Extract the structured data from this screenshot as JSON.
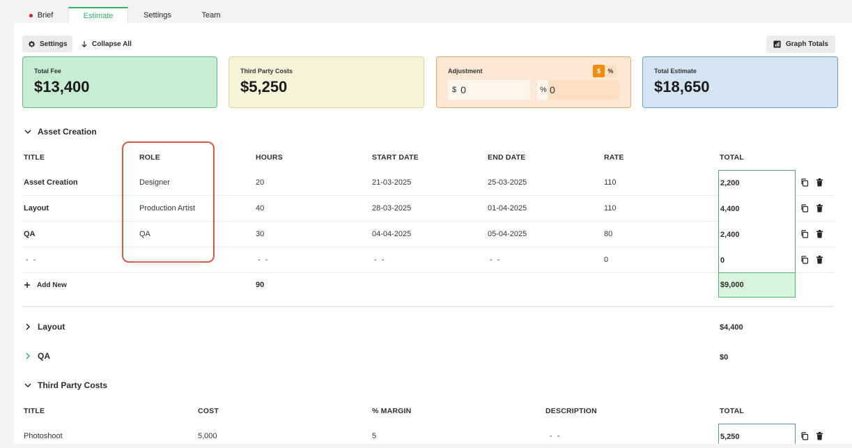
{
  "tabs": [
    {
      "label": "Brief",
      "active": false,
      "dot": true
    },
    {
      "label": "Estimate",
      "active": true
    },
    {
      "label": "Settings",
      "active": false
    },
    {
      "label": "Team",
      "active": false
    }
  ],
  "toolbar": {
    "settings_label": "Settings",
    "collapse_label": "Collapse All",
    "graph_label": "Graph Totals"
  },
  "cards": {
    "total_fee": {
      "label": "Total Fee",
      "value": "$13,400"
    },
    "third_party": {
      "label": "Third Party Costs",
      "value": "$5,250"
    },
    "adjustment": {
      "label": "Adjustment",
      "dollar_prefix": "$",
      "dollar_value": "0",
      "percent_prefix": "%",
      "percent_value": "0",
      "toggle_dollar": "$",
      "toggle_percent": "%"
    },
    "total_estimate": {
      "label": "Total Estimate",
      "value": "$18,650"
    }
  },
  "asset_section": {
    "title": "Asset Creation",
    "headers": {
      "title": "TITLE",
      "role": "ROLE",
      "hours": "HOURS",
      "start": "START DATE",
      "end": "END DATE",
      "rate": "RATE",
      "total": "TOTAL"
    },
    "rows": [
      {
        "title": "Asset Creation",
        "role": "Designer",
        "hours": "20",
        "start": "21-03-2025",
        "end": "25-03-2025",
        "rate": "110",
        "total": "2,200"
      },
      {
        "title": "Layout",
        "role": "Production Artist",
        "hours": "40",
        "start": "28-03-2025",
        "end": "01-04-2025",
        "rate": "110",
        "total": "4,400"
      },
      {
        "title": "QA",
        "role": "QA",
        "hours": "30",
        "start": "04-04-2025",
        "end": "05-04-2025",
        "rate": "80",
        "total": "2,400"
      },
      {
        "title": "- -",
        "role": "",
        "hours": "- -",
        "start": "- -",
        "end": "- -",
        "rate": "0",
        "total": "0"
      }
    ],
    "add_new_label": "Add New",
    "hours_total": "90",
    "grand_total": "$9,000"
  },
  "collapsed_sections": [
    {
      "title": "Layout",
      "total": "$4,400"
    },
    {
      "title": "QA",
      "total": "$0"
    }
  ],
  "third_party_section": {
    "title": "Third Party Costs",
    "headers": {
      "title": "TITLE",
      "cost": "COST",
      "margin": "% MARGIN",
      "description": "DESCRIPTION",
      "total": "TOTAL"
    },
    "rows": [
      {
        "title": "Photoshoot",
        "cost": "5,000",
        "margin": "5",
        "description": "- -",
        "total": "5,250"
      }
    ]
  },
  "colors": {
    "accent_green": "#2fb36b",
    "highlight_red": "#d65a46",
    "toggle_orange": "#f28c0f"
  }
}
